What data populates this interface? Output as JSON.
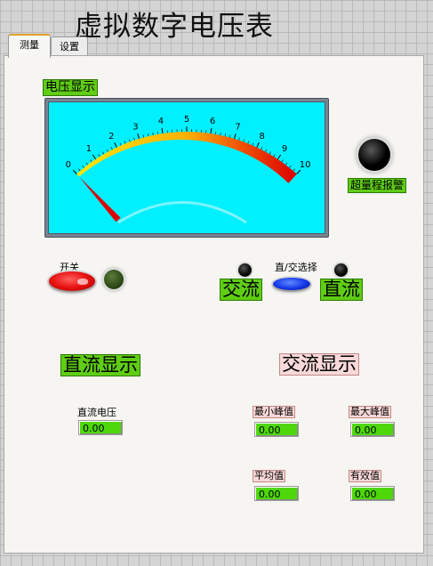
{
  "app": {
    "title": "虚拟数字电压表"
  },
  "tabs": [
    {
      "label": "测量",
      "active": true
    },
    {
      "label": "设置",
      "active": false
    }
  ],
  "meter": {
    "label": "电压显示",
    "scale_min": 0,
    "scale_max": 10,
    "ticks": [
      "0",
      "1",
      "2",
      "3",
      "4",
      "5",
      "6",
      "7",
      "8",
      "9",
      "10"
    ],
    "value": 0
  },
  "overrange": {
    "label": "超量程报警",
    "on": false
  },
  "power_switch": {
    "label": "开关",
    "on": true
  },
  "mode": {
    "label": "直/交选择",
    "ac_label": "交流",
    "dc_label": "直流"
  },
  "dc_section": {
    "title": "直流显示",
    "voltage_label": "直流电压",
    "voltage_value": "0.00"
  },
  "ac_section": {
    "title": "交流显示",
    "min_peak_label": "最小峰值",
    "min_peak_value": "0.00",
    "max_peak_label": "最大峰值",
    "max_peak_value": "0.00",
    "avg_label": "平均值",
    "avg_value": "0.00",
    "rms_label": "有效值",
    "rms_value": "0.00"
  },
  "colors": {
    "meter_face": "#00f0ff",
    "label_green": "#5fcd14",
    "display_green": "#4ed80a",
    "switch_red": "#e81010",
    "selector_blue": "#1438e8",
    "led_dark_green": "#2e4a18"
  }
}
